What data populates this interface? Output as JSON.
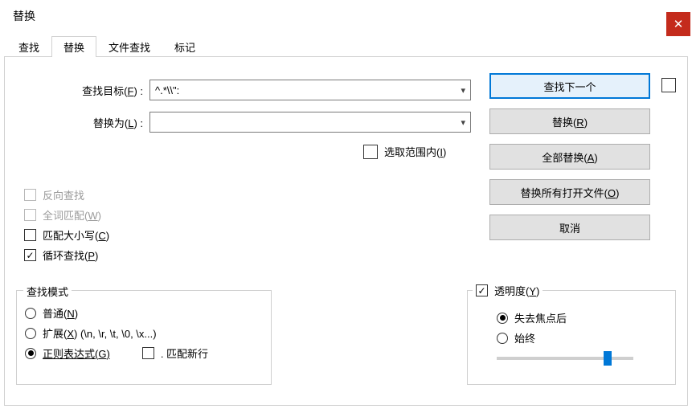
{
  "window": {
    "title": "替换",
    "close": "✕"
  },
  "tabs": {
    "find": "查找",
    "replace": "替换",
    "findfiles": "文件查找",
    "mark": "标记"
  },
  "labels": {
    "find_target_pre": "查找目标(",
    "find_target_u": "F",
    "find_target_post": ") :",
    "replace_with_pre": "替换为(",
    "replace_with_u": "L",
    "replace_with_post": ") :"
  },
  "inputs": {
    "find_value": "^.*\\\\\":",
    "replace_value": ""
  },
  "inSelection": {
    "pre": "选取范围内(",
    "u": "I",
    "post": ")"
  },
  "buttons": {
    "find_next": "查找下一个",
    "replace_pre": "替换(",
    "replace_u": "R",
    "replace_post": ")",
    "replace_all_pre": "全部替换(",
    "replace_all_u": "A",
    "replace_all_post": ")",
    "replace_open_pre": "替换所有打开文件(",
    "replace_open_u": "O",
    "replace_open_post": ")",
    "cancel": "取消"
  },
  "options": {
    "reverse": "反向查找",
    "whole_pre": "全词匹配(",
    "whole_u": "W",
    "whole_post": ")",
    "case_pre": "匹配大小写(",
    "case_u": "C",
    "case_post": ")",
    "wrap_pre": "循环查找(",
    "wrap_u": "P",
    "wrap_post": ")"
  },
  "mode": {
    "legend": "查找模式",
    "normal_pre": "普通(",
    "normal_u": "N",
    "normal_post": ")",
    "ext_pre": "扩展(",
    "ext_u": "X",
    "ext_post": ") (\\n, \\r, \\t, \\0, \\x...)",
    "regex_pre": "正则表达式(",
    "regex_u": "G",
    "regex_post": ")",
    "newline": ". 匹配新行"
  },
  "trans": {
    "label_pre": "透明度(",
    "label_u": "Y",
    "label_post": ")",
    "onlose": "失去焦点后",
    "always": "始终"
  }
}
